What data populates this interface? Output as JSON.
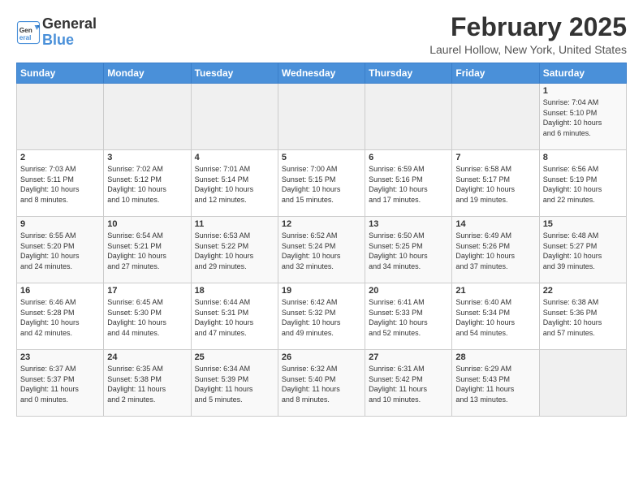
{
  "header": {
    "logo_general": "General",
    "logo_blue": "Blue",
    "month": "February 2025",
    "location": "Laurel Hollow, New York, United States"
  },
  "weekdays": [
    "Sunday",
    "Monday",
    "Tuesday",
    "Wednesday",
    "Thursday",
    "Friday",
    "Saturday"
  ],
  "weeks": [
    [
      {
        "day": "",
        "info": ""
      },
      {
        "day": "",
        "info": ""
      },
      {
        "day": "",
        "info": ""
      },
      {
        "day": "",
        "info": ""
      },
      {
        "day": "",
        "info": ""
      },
      {
        "day": "",
        "info": ""
      },
      {
        "day": "1",
        "info": "Sunrise: 7:04 AM\nSunset: 5:10 PM\nDaylight: 10 hours\nand 6 minutes."
      }
    ],
    [
      {
        "day": "2",
        "info": "Sunrise: 7:03 AM\nSunset: 5:11 PM\nDaylight: 10 hours\nand 8 minutes."
      },
      {
        "day": "3",
        "info": "Sunrise: 7:02 AM\nSunset: 5:12 PM\nDaylight: 10 hours\nand 10 minutes."
      },
      {
        "day": "4",
        "info": "Sunrise: 7:01 AM\nSunset: 5:14 PM\nDaylight: 10 hours\nand 12 minutes."
      },
      {
        "day": "5",
        "info": "Sunrise: 7:00 AM\nSunset: 5:15 PM\nDaylight: 10 hours\nand 15 minutes."
      },
      {
        "day": "6",
        "info": "Sunrise: 6:59 AM\nSunset: 5:16 PM\nDaylight: 10 hours\nand 17 minutes."
      },
      {
        "day": "7",
        "info": "Sunrise: 6:58 AM\nSunset: 5:17 PM\nDaylight: 10 hours\nand 19 minutes."
      },
      {
        "day": "8",
        "info": "Sunrise: 6:56 AM\nSunset: 5:19 PM\nDaylight: 10 hours\nand 22 minutes."
      }
    ],
    [
      {
        "day": "9",
        "info": "Sunrise: 6:55 AM\nSunset: 5:20 PM\nDaylight: 10 hours\nand 24 minutes."
      },
      {
        "day": "10",
        "info": "Sunrise: 6:54 AM\nSunset: 5:21 PM\nDaylight: 10 hours\nand 27 minutes."
      },
      {
        "day": "11",
        "info": "Sunrise: 6:53 AM\nSunset: 5:22 PM\nDaylight: 10 hours\nand 29 minutes."
      },
      {
        "day": "12",
        "info": "Sunrise: 6:52 AM\nSunset: 5:24 PM\nDaylight: 10 hours\nand 32 minutes."
      },
      {
        "day": "13",
        "info": "Sunrise: 6:50 AM\nSunset: 5:25 PM\nDaylight: 10 hours\nand 34 minutes."
      },
      {
        "day": "14",
        "info": "Sunrise: 6:49 AM\nSunset: 5:26 PM\nDaylight: 10 hours\nand 37 minutes."
      },
      {
        "day": "15",
        "info": "Sunrise: 6:48 AM\nSunset: 5:27 PM\nDaylight: 10 hours\nand 39 minutes."
      }
    ],
    [
      {
        "day": "16",
        "info": "Sunrise: 6:46 AM\nSunset: 5:28 PM\nDaylight: 10 hours\nand 42 minutes."
      },
      {
        "day": "17",
        "info": "Sunrise: 6:45 AM\nSunset: 5:30 PM\nDaylight: 10 hours\nand 44 minutes."
      },
      {
        "day": "18",
        "info": "Sunrise: 6:44 AM\nSunset: 5:31 PM\nDaylight: 10 hours\nand 47 minutes."
      },
      {
        "day": "19",
        "info": "Sunrise: 6:42 AM\nSunset: 5:32 PM\nDaylight: 10 hours\nand 49 minutes."
      },
      {
        "day": "20",
        "info": "Sunrise: 6:41 AM\nSunset: 5:33 PM\nDaylight: 10 hours\nand 52 minutes."
      },
      {
        "day": "21",
        "info": "Sunrise: 6:40 AM\nSunset: 5:34 PM\nDaylight: 10 hours\nand 54 minutes."
      },
      {
        "day": "22",
        "info": "Sunrise: 6:38 AM\nSunset: 5:36 PM\nDaylight: 10 hours\nand 57 minutes."
      }
    ],
    [
      {
        "day": "23",
        "info": "Sunrise: 6:37 AM\nSunset: 5:37 PM\nDaylight: 11 hours\nand 0 minutes."
      },
      {
        "day": "24",
        "info": "Sunrise: 6:35 AM\nSunset: 5:38 PM\nDaylight: 11 hours\nand 2 minutes."
      },
      {
        "day": "25",
        "info": "Sunrise: 6:34 AM\nSunset: 5:39 PM\nDaylight: 11 hours\nand 5 minutes."
      },
      {
        "day": "26",
        "info": "Sunrise: 6:32 AM\nSunset: 5:40 PM\nDaylight: 11 hours\nand 8 minutes."
      },
      {
        "day": "27",
        "info": "Sunrise: 6:31 AM\nSunset: 5:42 PM\nDaylight: 11 hours\nand 10 minutes."
      },
      {
        "day": "28",
        "info": "Sunrise: 6:29 AM\nSunset: 5:43 PM\nDaylight: 11 hours\nand 13 minutes."
      },
      {
        "day": "",
        "info": ""
      }
    ]
  ]
}
